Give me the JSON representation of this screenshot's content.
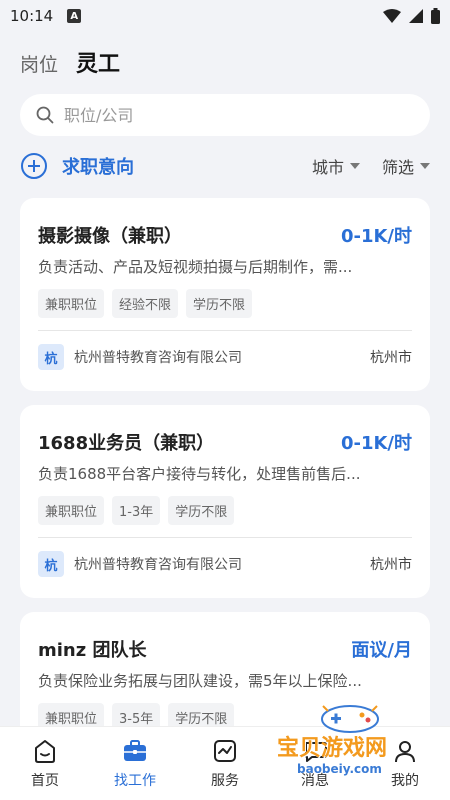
{
  "status_bar": {
    "time": "10:14",
    "notif_glyph": "A"
  },
  "header": {
    "tab_position": "岗位",
    "tab_gig": "灵工"
  },
  "search": {
    "placeholder": "职位/公司"
  },
  "intent": {
    "label": "求职意向"
  },
  "filters": {
    "city": "城市",
    "screen": "筛选"
  },
  "jobs": [
    {
      "title": "摄影摄像（兼职）",
      "salary": "0-1K/时",
      "desc": "负责活动、产品及短视频拍摄与后期制作，需...",
      "tags": [
        "兼职职位",
        "经验不限",
        "学历不限"
      ],
      "company_logo": "杭",
      "company": "杭州普特教育咨询有限公司",
      "city": "杭州市"
    },
    {
      "title": "1688业务员（兼职）",
      "salary": "0-1K/时",
      "desc": "负责1688平台客户接待与转化，处理售前售后...",
      "tags": [
        "兼职职位",
        "1-3年",
        "学历不限"
      ],
      "company_logo": "杭",
      "company": "杭州普特教育咨询有限公司",
      "city": "杭州市"
    },
    {
      "title": "minz 团队长",
      "salary": "面议/月",
      "desc": "负责保险业务拓展与团队建设，需5年以上保险...",
      "tags": [
        "兼职职位",
        "3-5年",
        "学历不限"
      ]
    }
  ],
  "nav": {
    "home": "首页",
    "find_job": "找工作",
    "service": "服务",
    "message": "消息",
    "mine": "我的"
  },
  "watermark": {
    "title": "宝贝游戏网",
    "url": "baobeiy.com"
  },
  "colors": {
    "accent": "#2a6fd6",
    "watermark": "#f39a1e"
  }
}
